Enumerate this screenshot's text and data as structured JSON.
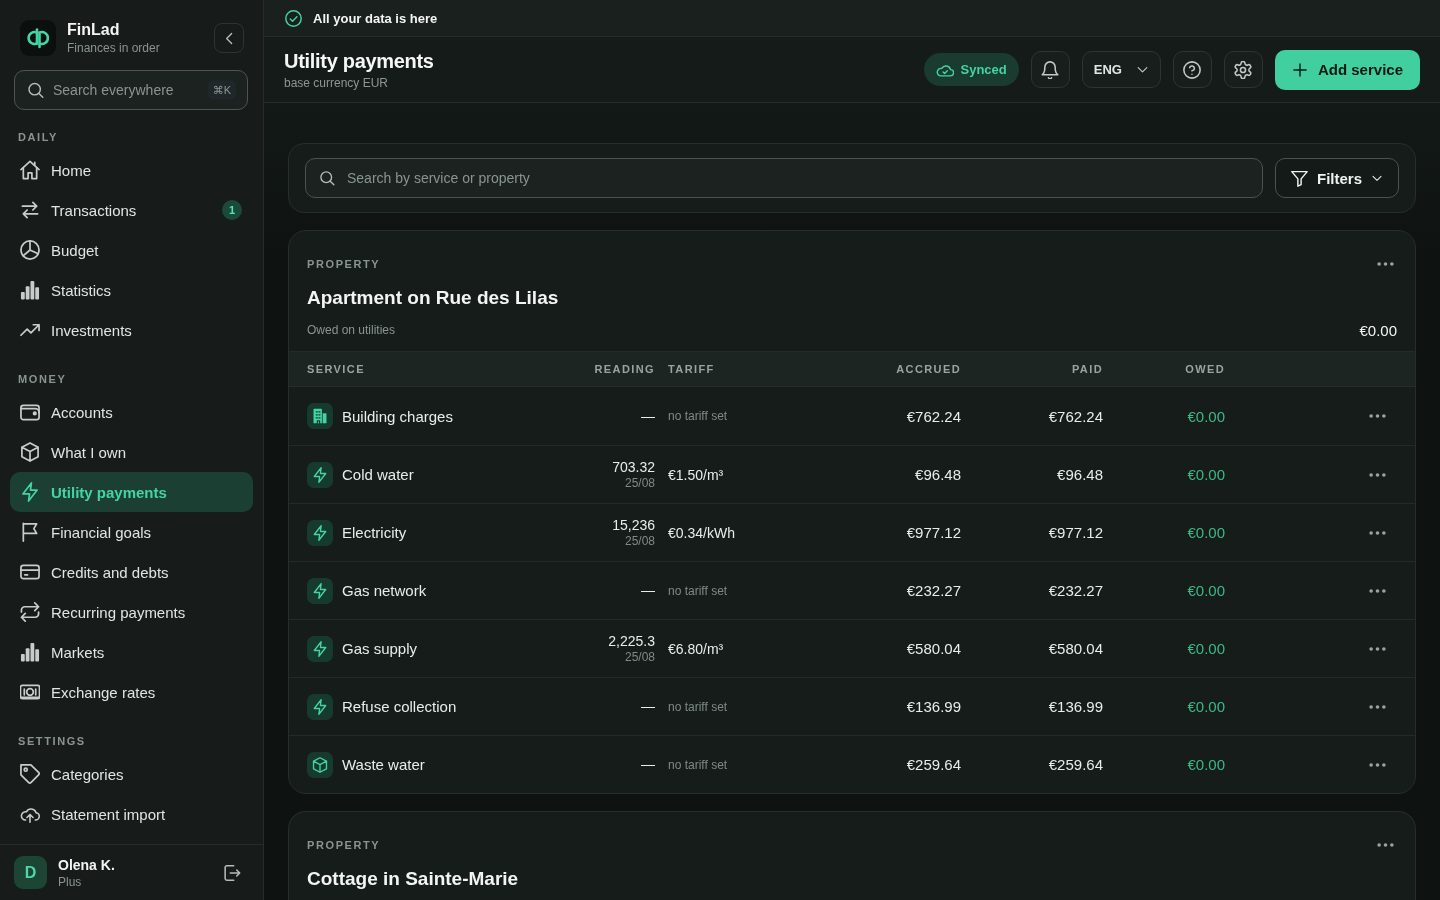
{
  "sidebar": {
    "brand": {
      "name": "FinLad",
      "tagline": "Finances in order"
    },
    "search": {
      "placeholder": "Search everywhere",
      "shortcut": "⌘K"
    },
    "sections": [
      {
        "title": "DAILY",
        "items": [
          {
            "label": "Home",
            "selected": false
          },
          {
            "label": "Transactions",
            "selected": false,
            "badge": "1"
          },
          {
            "label": "Budget",
            "selected": false
          },
          {
            "label": "Statistics",
            "selected": false
          },
          {
            "label": "Investments",
            "selected": false
          }
        ]
      },
      {
        "title": "MONEY",
        "items": [
          {
            "label": "Accounts",
            "selected": false
          },
          {
            "label": "What I own",
            "selected": false
          },
          {
            "label": "Utility payments",
            "selected": true
          },
          {
            "label": "Financial goals",
            "selected": false
          },
          {
            "label": "Credits and debts",
            "selected": false
          },
          {
            "label": "Recurring payments",
            "selected": false
          },
          {
            "label": "Markets",
            "selected": false
          },
          {
            "label": "Exchange rates",
            "selected": false
          }
        ]
      },
      {
        "title": "SETTINGS",
        "items": [
          {
            "label": "Categories",
            "selected": false
          },
          {
            "label": "Statement import",
            "selected": false
          }
        ]
      }
    ],
    "user": {
      "initial": "D",
      "name": "Olena K.",
      "plan": "Plus"
    }
  },
  "banner": {
    "text": "All your data is here"
  },
  "header": {
    "title": "Utility payments",
    "subtitle": "base currency EUR",
    "sync_status": "Synced",
    "language": "ENG",
    "add_button": "Add service"
  },
  "filter_bar": {
    "search": {
      "placeholder": "Search by service or property"
    },
    "filters_button": "Filters"
  },
  "properties": [
    {
      "label": "PROPERTY",
      "name": "Apartment on Rue des Lilas",
      "owed_label": "Owed on utilities",
      "owed_total": "€0.00",
      "table": {
        "columns": [
          "SERVICE",
          "READING",
          "TARIFF",
          "ACCRUED",
          "PAID",
          "OWED"
        ],
        "rows": [
          {
            "service": "Building charges",
            "reading": "—",
            "tariff": "no tariff set",
            "tariff_set": false,
            "accrued": "€762.24",
            "paid": "€762.24",
            "owed": "€0.00"
          },
          {
            "service": "Cold water",
            "reading": "703.32",
            "reading_date": "25/08",
            "tariff": "€1.50/m³",
            "tariff_set": true,
            "accrued": "€96.48",
            "paid": "€96.48",
            "owed": "€0.00"
          },
          {
            "service": "Electricity",
            "reading": "15,236",
            "reading_date": "25/08",
            "tariff": "€0.34/kWh",
            "tariff_set": true,
            "accrued": "€977.12",
            "paid": "€977.12",
            "owed": "€0.00"
          },
          {
            "service": "Gas network",
            "reading": "—",
            "tariff": "no tariff set",
            "tariff_set": false,
            "accrued": "€232.27",
            "paid": "€232.27",
            "owed": "€0.00"
          },
          {
            "service": "Gas supply",
            "reading": "2,225.3",
            "reading_date": "25/08",
            "tariff": "€6.80/m³",
            "tariff_set": true,
            "accrued": "€580.04",
            "paid": "€580.04",
            "owed": "€0.00"
          },
          {
            "service": "Refuse collection",
            "reading": "—",
            "tariff": "no tariff set",
            "tariff_set": false,
            "accrued": "€136.99",
            "paid": "€136.99",
            "owed": "€0.00"
          },
          {
            "service": "Waste water",
            "reading": "—",
            "tariff": "no tariff set",
            "tariff_set": false,
            "accrued": "€259.64",
            "paid": "€259.64",
            "owed": "€0.00"
          }
        ]
      }
    },
    {
      "label": "PROPERTY",
      "name": "Cottage in Sainte-Marie"
    }
  ]
}
